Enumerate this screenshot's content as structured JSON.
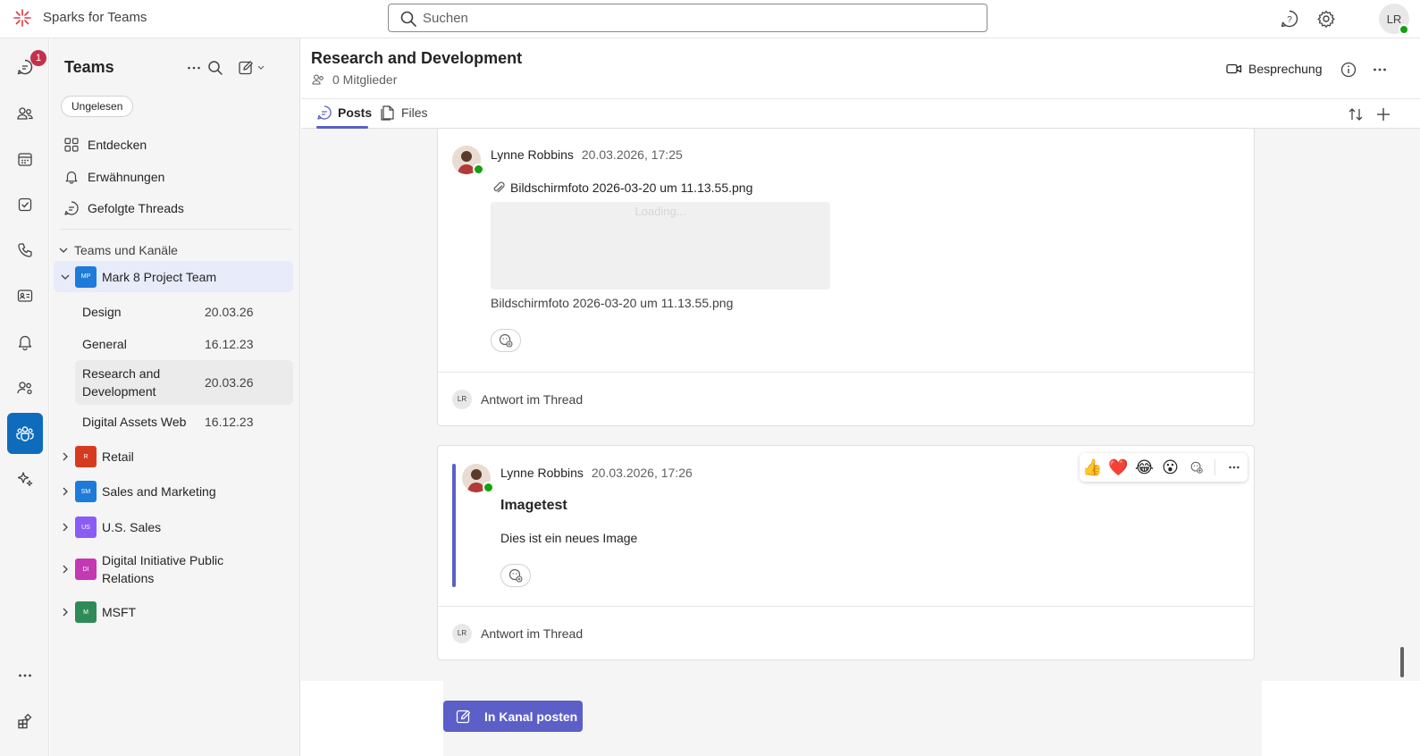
{
  "app": {
    "title": "Sparks for Teams",
    "user_initials": "LR"
  },
  "search": {
    "placeholder": "Suchen"
  },
  "rail": {
    "chat_badge": "1"
  },
  "sidebar": {
    "title": "Teams",
    "filter_chip": "Ungelesen",
    "nav": [
      {
        "label": "Entdecken",
        "icon": "grid-icon"
      },
      {
        "label": "Erwähnungen",
        "icon": "bell-icon"
      },
      {
        "label": "Gefolgte Threads",
        "icon": "chat-icon"
      }
    ],
    "section_label": "Teams und Kanäle",
    "teams": [
      {
        "name": "Mark 8 Project Team",
        "abbr": "MP",
        "color": "#1e7bd9"
      },
      {
        "name": "Retail",
        "abbr": "R",
        "color": "#d73b1f"
      },
      {
        "name": "Sales and Marketing",
        "abbr": "SM",
        "color": "#1e7bd9"
      },
      {
        "name": "U.S. Sales",
        "abbr": "US",
        "color": "#8a5cf6"
      },
      {
        "name": "Digital Initiative Public Relations",
        "abbr": "DI",
        "color": "#c239b3"
      },
      {
        "name": "MSFT",
        "abbr": "M",
        "color": "#2e8b57"
      }
    ],
    "channels": [
      {
        "name": "Design",
        "date": "20.03.26"
      },
      {
        "name": "General",
        "date": "16.12.23"
      },
      {
        "name": "Research and Development",
        "date": "20.03.26"
      },
      {
        "name": "Digital Assets Web",
        "date": "16.12.23"
      }
    ]
  },
  "channel": {
    "title": "Research and Development",
    "members": "0 Mitglieder",
    "meeting_label": "Besprechung",
    "tabs": [
      "Posts",
      "Files"
    ]
  },
  "posts": [
    {
      "author": "Lynne Robbins",
      "time": "20.03.2026, 17:25",
      "attachment": "Bildschirmfoto 2026-03-20 um 11.13.55.png",
      "loading_text": "Loading...",
      "caption": "Bildschirmfoto 2026-03-20 um 11.13.55.png",
      "reply_label": "Antwort im Thread"
    },
    {
      "author": "Lynne Robbins",
      "time": "20.03.2026, 17:26",
      "subject": "Imagetest",
      "body": "Dies ist ein neues Image",
      "reactions": [
        "👍",
        "❤️",
        "😂",
        "😮"
      ],
      "reply_label": "Antwort im Thread"
    }
  ],
  "compose": {
    "post_button": "In Kanal posten"
  },
  "colors": {
    "accent": "#5b5fc7",
    "rail_active": "#0f6cbd",
    "badge": "#c4314b",
    "presence": "#13a10e"
  }
}
